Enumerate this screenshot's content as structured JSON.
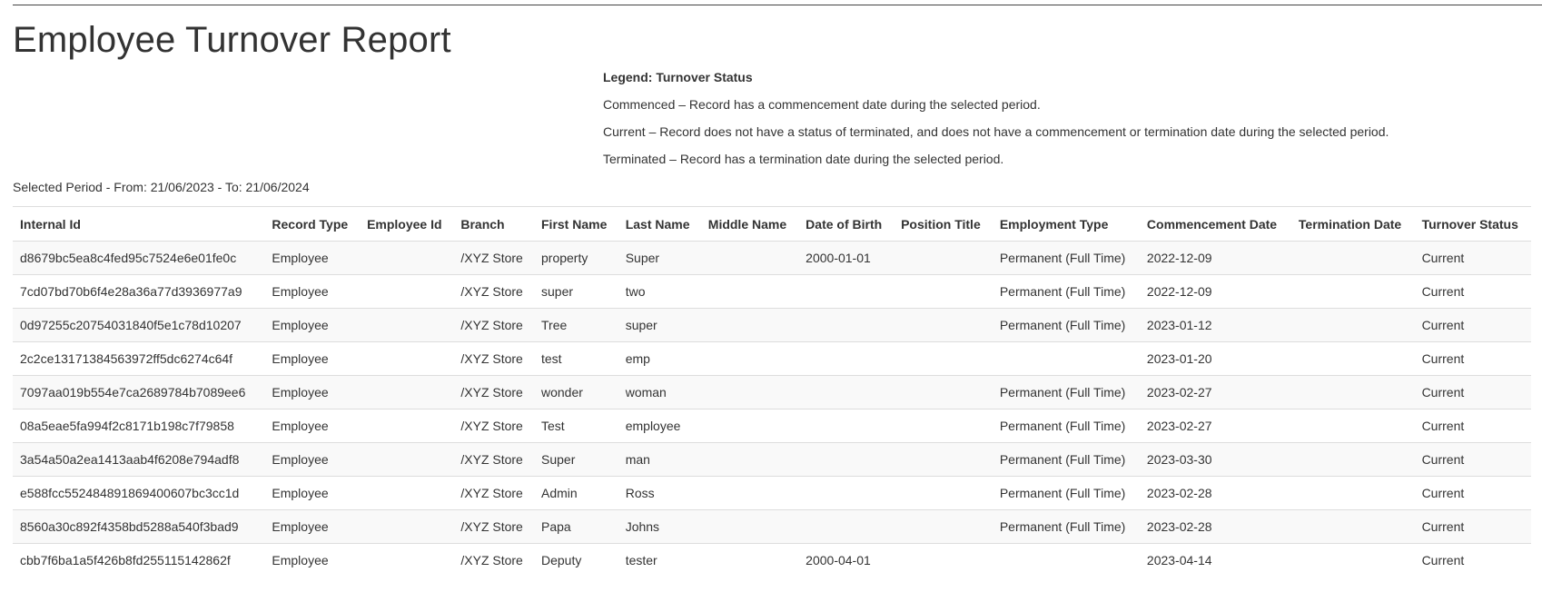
{
  "page": {
    "title": "Employee Turnover Report",
    "period": "Selected Period - From: 21/06/2023 - To: 21/06/2024"
  },
  "legend": {
    "heading": "Legend: Turnover Status",
    "commenced": "Commenced – Record has a commencement date during the selected period.",
    "current": "Current – Record does not have a status of terminated, and does not have a commencement or termination date during the selected period.",
    "terminated": "Terminated – Record has a termination date during the selected period."
  },
  "table": {
    "columns": [
      "Internal Id",
      "Record Type",
      "Employee Id",
      "Branch",
      "First Name",
      "Last Name",
      "Middle Name",
      "Date of Birth",
      "Position Title",
      "Employment Type",
      "Commencement Date",
      "Termination Date",
      "Turnover Status"
    ],
    "rows": [
      [
        "d8679bc5ea8c4fed95c7524e6e01fe0c",
        "Employee",
        "",
        "/XYZ Store",
        "property",
        "Super",
        "",
        "2000-01-01",
        "",
        "Permanent (Full Time)",
        "2022-12-09",
        "",
        "Current"
      ],
      [
        "7cd07bd70b6f4e28a36a77d3936977a9",
        "Employee",
        "",
        "/XYZ Store",
        "super",
        "two",
        "",
        "",
        "",
        "Permanent (Full Time)",
        "2022-12-09",
        "",
        "Current"
      ],
      [
        "0d97255c20754031840f5e1c78d10207",
        "Employee",
        "",
        "/XYZ Store",
        "Tree",
        "super",
        "",
        "",
        "",
        "Permanent (Full Time)",
        "2023-01-12",
        "",
        "Current"
      ],
      [
        "2c2ce13171384563972ff5dc6274c64f",
        "Employee",
        "",
        "/XYZ Store",
        "test",
        "emp",
        "",
        "",
        "",
        "",
        "2023-01-20",
        "",
        "Current"
      ],
      [
        "7097aa019b554e7ca2689784b7089ee6",
        "Employee",
        "",
        "/XYZ Store",
        "wonder",
        "woman",
        "",
        "",
        "",
        "Permanent (Full Time)",
        "2023-02-27",
        "",
        "Current"
      ],
      [
        "08a5eae5fa994f2c8171b198c7f79858",
        "Employee",
        "",
        "/XYZ Store",
        "Test",
        "employee",
        "",
        "",
        "",
        "Permanent (Full Time)",
        "2023-02-27",
        "",
        "Current"
      ],
      [
        "3a54a50a2ea1413aab4f6208e794adf8",
        "Employee",
        "",
        "/XYZ Store",
        "Super",
        "man",
        "",
        "",
        "",
        "Permanent (Full Time)",
        "2023-03-30",
        "",
        "Current"
      ],
      [
        "e588fcc552484891869400607bc3cc1d",
        "Employee",
        "",
        "/XYZ Store",
        "Admin",
        "Ross",
        "",
        "",
        "",
        "Permanent (Full Time)",
        "2023-02-28",
        "",
        "Current"
      ],
      [
        "8560a30c892f4358bd5288a540f3bad9",
        "Employee",
        "",
        "/XYZ Store",
        "Papa",
        "Johns",
        "",
        "",
        "",
        "Permanent (Full Time)",
        "2023-02-28",
        "",
        "Current"
      ],
      [
        "cbb7f6ba1a5f426b8fd255115142862f",
        "Employee",
        "",
        "/XYZ Store",
        "Deputy",
        "tester",
        "",
        "2000-04-01",
        "",
        "",
        "2023-04-14",
        "",
        "Current"
      ]
    ]
  },
  "colors": {
    "text": "#333333",
    "stripe": "#f9f9f9",
    "border": "#dddddd"
  }
}
